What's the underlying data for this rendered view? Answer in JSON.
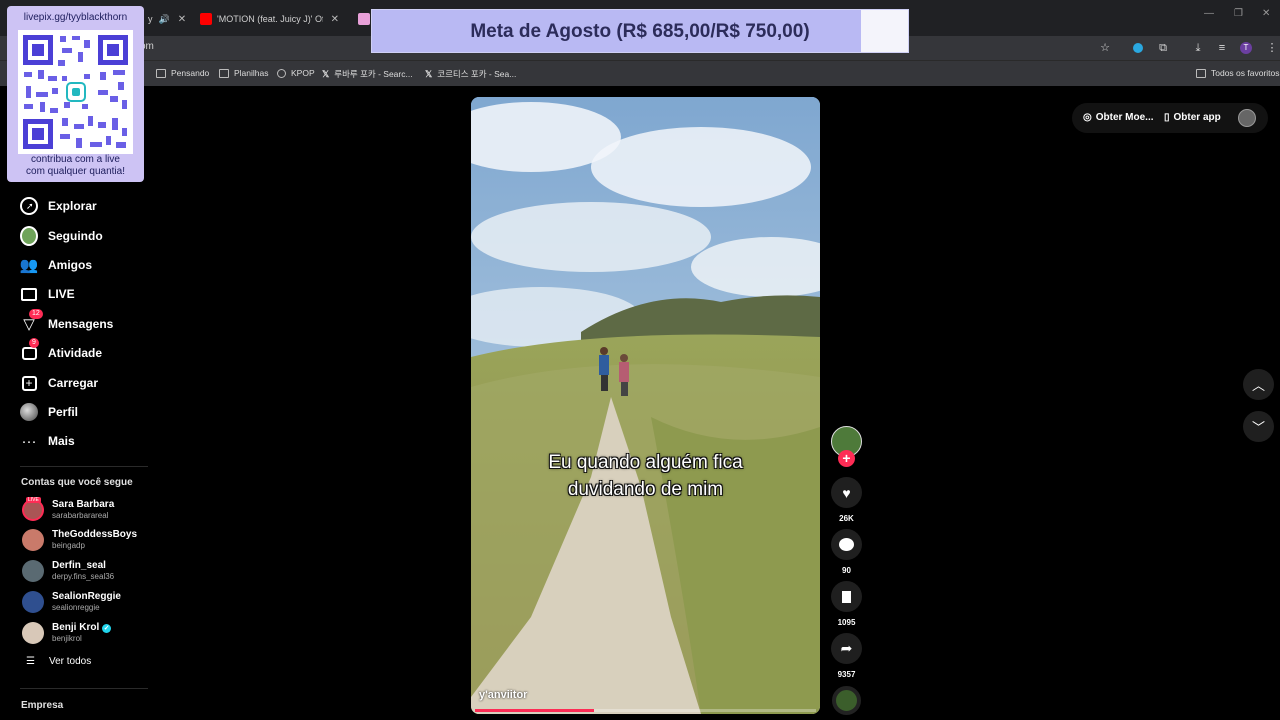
{
  "browser": {
    "tabs": [
      {
        "title": "y",
        "audio_icon": "speaker-icon"
      },
      {
        "title": "'MOTION (feat. Juicy J)' Official",
        "favicon": "youtube-icon"
      },
      {
        "title": "",
        "favicon": "m-app-icon"
      }
    ],
    "url": "om",
    "bookmarks": [
      {
        "label": "Pensando",
        "icon": "folder-icon"
      },
      {
        "label": "Planilhas",
        "icon": "folder-icon"
      },
      {
        "label": "KPOP",
        "icon": "globe-icon"
      },
      {
        "label": "루바루 포카 - Searc...",
        "icon": "x-icon"
      },
      {
        "label": "코르티스 포카 - Sea...",
        "icon": "x-icon"
      }
    ],
    "all_bookmarks": "Todos os favoritos",
    "profile_initial": "T"
  },
  "overlay": {
    "goal_text": "Meta de Agosto (R$ 685,00/R$ 750,00)",
    "goal_progress": 0.913,
    "qr_title": "livepix.gg/tyyblackthorn",
    "qr_caption_line1": "contribua com a live",
    "qr_caption_line2": "com qualquer quantia!"
  },
  "sidebar": {
    "nav": [
      {
        "label": "Explorar",
        "icon": "compass-icon"
      },
      {
        "label": "Seguindo",
        "icon": "following-icon"
      },
      {
        "label": "Amigos",
        "icon": "friends-icon"
      },
      {
        "label": "LIVE",
        "icon": "live-tv-icon"
      },
      {
        "label": "Mensagens",
        "icon": "messages-icon",
        "badge": "12"
      },
      {
        "label": "Atividade",
        "icon": "activity-icon",
        "badge": "9"
      },
      {
        "label": "Carregar",
        "icon": "upload-icon"
      },
      {
        "label": "Perfil",
        "icon": "profile-avatar"
      },
      {
        "label": "Mais",
        "icon": "more-icon"
      }
    ],
    "following_title": "Contas que você segue",
    "accounts": [
      {
        "name": "Sara Barbara",
        "username": "sarabarbarareal",
        "live": true,
        "live_label": "LIVE"
      },
      {
        "name": "TheGoddessBoys",
        "username": "beingadp"
      },
      {
        "name": "Derfin_seal",
        "username": "derpy.fins_seal36"
      },
      {
        "name": "SealionReggie",
        "username": "sealionreggie"
      },
      {
        "name": "Benji Krol",
        "username": "benjikrol",
        "verified": true
      }
    ],
    "see_all": "Ver todos",
    "company": "Empresa"
  },
  "video": {
    "caption_line1": "Eu quando alguém fica",
    "caption_line2": "duvidando de mim",
    "credit": "y'anviitor",
    "progress": 0.35
  },
  "actions": {
    "likes": "26K",
    "comments": "90",
    "saves": "1095",
    "shares": "9357"
  },
  "topright": {
    "coins": "Obter Moe...",
    "app": "Obter app"
  },
  "colors": {
    "accent": "#fe2c55",
    "goal_fill": "#b9b9f3",
    "qr_bg": "#cdc3f4"
  }
}
